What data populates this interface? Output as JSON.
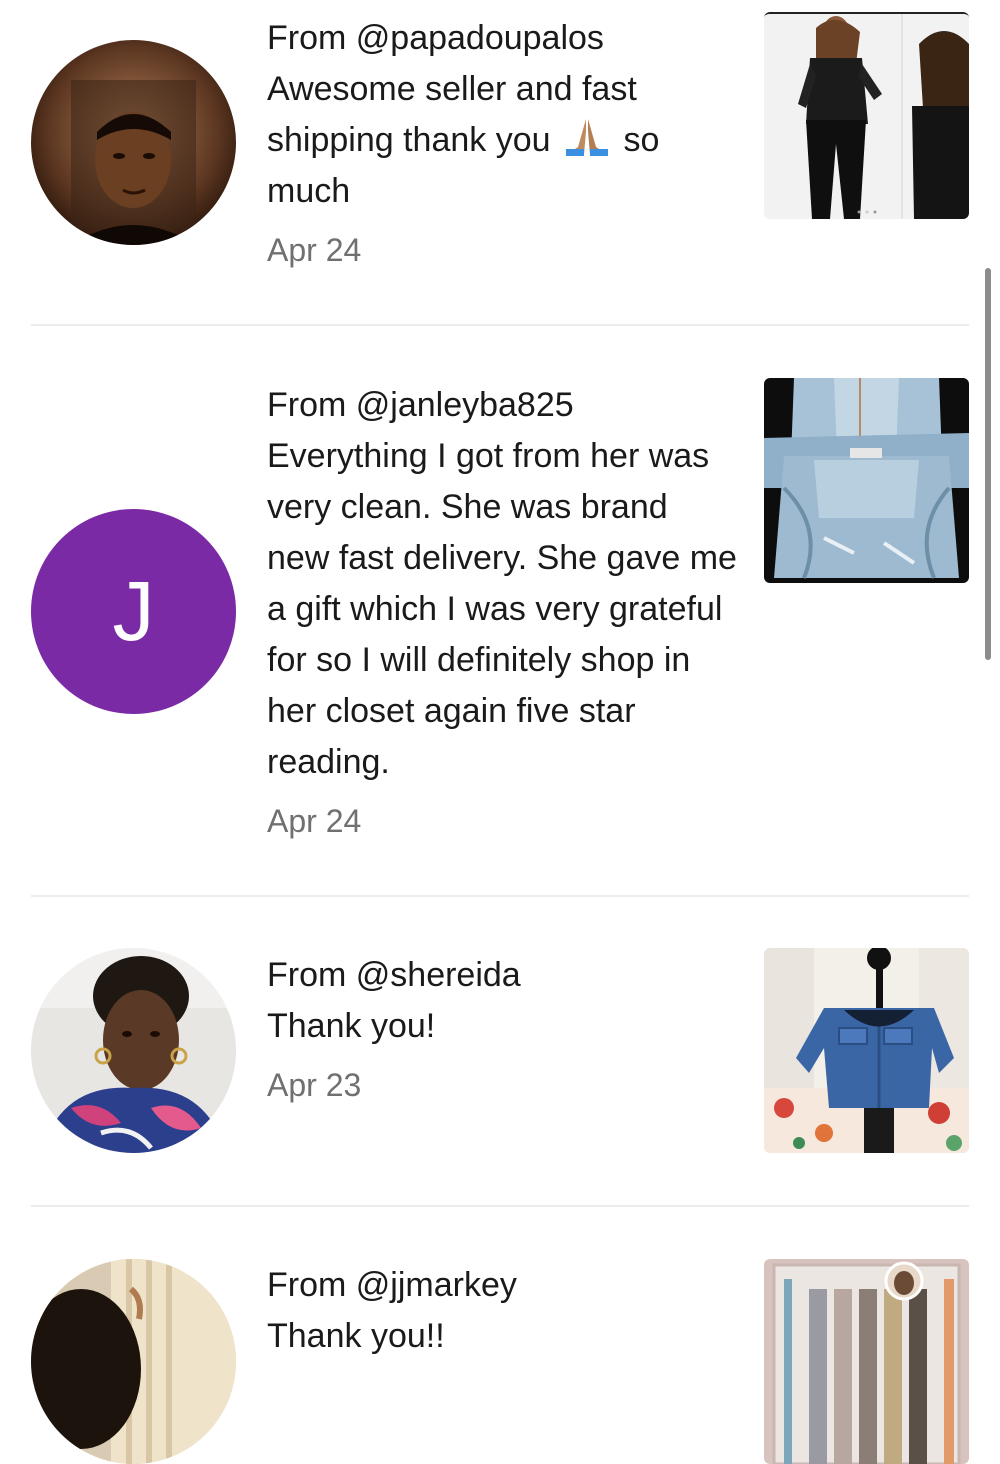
{
  "reviews": [
    {
      "from": "From @papadoupalos",
      "text_before_emoji": "Awesome seller and fast shipping thank you",
      "emoji": "folded-hands-emoji",
      "text_after_emoji": "so much",
      "date": "Apr 24",
      "avatar": "photo-man",
      "thumb": "lace-jumpsuit-photo"
    },
    {
      "from": "From @janleyba825",
      "text": "Everything I got from her was very clean. She was brand new fast delivery. She gave me a gift which I was very grateful for so I will definitely shop in her closet again five star reading.",
      "date": "Apr 24",
      "avatar_letter": "J",
      "avatar_color": "#7b2aa6",
      "thumb": "denim-overalls-photo"
    },
    {
      "from": "From @shereida",
      "text": "Thank you!",
      "date": "Apr 23",
      "avatar": "photo-woman",
      "thumb": "denim-jacket-photo"
    },
    {
      "from": "From @jjmarkey",
      "text": "Thank you!!",
      "avatar": "photo-person",
      "thumb": "makeup-box-photo"
    }
  ]
}
